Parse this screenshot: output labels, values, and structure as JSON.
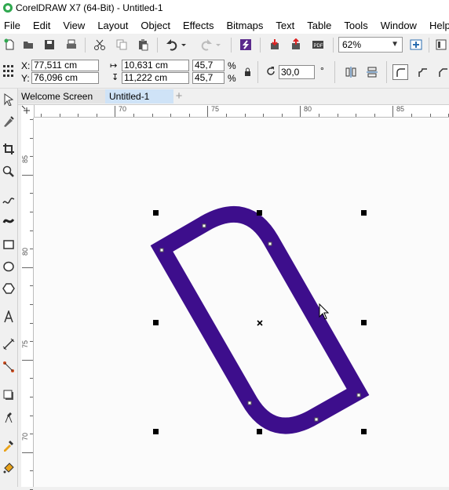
{
  "window": {
    "title": "CorelDRAW X7 (64-Bit) - Untitled-1"
  },
  "menu": [
    "File",
    "Edit",
    "View",
    "Layout",
    "Object",
    "Effects",
    "Bitmaps",
    "Text",
    "Table",
    "Tools",
    "Window",
    "Help"
  ],
  "toolbar": {
    "zoom": "62%",
    "icons": [
      "new-document-icon",
      "open-icon",
      "save-icon",
      "print-icon",
      "cut-icon",
      "copy-icon",
      "paste-icon",
      "undo-icon",
      "redo-icon",
      "search-content-icon",
      "import-icon",
      "export-icon",
      "publish-pdf-icon",
      "zoom-dropdown",
      "full-screen-icon",
      "options-icon"
    ]
  },
  "properties": {
    "x_label": "X:",
    "x_value": "77,511 cm",
    "y_label": "Y:",
    "y_value": "76,096 cm",
    "width_value": "10,631 cm",
    "height_value": "11,222 cm",
    "scale_x": "45,7",
    "scale_y": "45,7",
    "percent_sign": "%",
    "rotation": "30,0",
    "degree_sign": "°"
  },
  "tabs": {
    "welcome": "Welcome Screen",
    "document": "Untitled-1",
    "add": "+"
  },
  "ruler": {
    "horizontal": [
      "70",
      "75",
      "80",
      "85"
    ],
    "vertical": [
      "85",
      "80",
      "75",
      "70"
    ]
  },
  "colors": {
    "shape_outline": "#3d0e8c",
    "canvas": "#fbfbfb",
    "selection_handle": "#000000",
    "active_tab": "#cfe3f7"
  },
  "tools": [
    "pick-tool-icon",
    "shape-tool-icon",
    "crop-tool-icon",
    "zoom-tool-icon",
    "freehand-tool-icon",
    "artistic-media-icon",
    "rectangle-tool-icon",
    "ellipse-tool-icon",
    "polygon-tool-icon",
    "text-tool-icon",
    "parallel-dimension-icon",
    "connector-tool-icon",
    "drop-shadow-icon",
    "transparency-icon",
    "eyedropper-icon",
    "interactive-fill-icon",
    "smart-fill-icon"
  ]
}
